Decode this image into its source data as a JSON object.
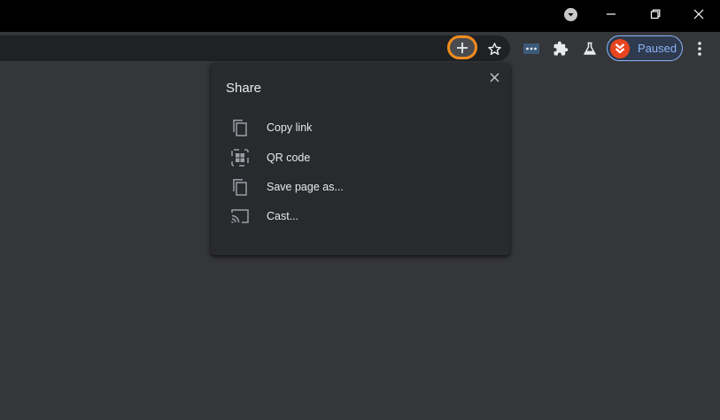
{
  "window_controls": {
    "icons": [
      "tab-search-icon",
      "minimize-icon",
      "restore-icon",
      "close-icon"
    ]
  },
  "toolbar": {
    "icons": [
      "share-icon",
      "bookmark-star-icon",
      "extension-dots-icon",
      "extensions-puzzle-icon",
      "labs-flask-icon",
      "more-menu-icon"
    ],
    "profile_label": "Paused",
    "accent_color": "#8ab4f8",
    "highlight_color": "#f28c1e"
  },
  "share_bubble": {
    "title": "Share",
    "items": [
      {
        "label": "Copy link",
        "icon": "copy-icon"
      },
      {
        "label": "QR code",
        "icon": "qr-code-icon"
      },
      {
        "label": "Save page as...",
        "icon": "save-page-icon"
      },
      {
        "label": "Cast...",
        "icon": "cast-icon"
      }
    ]
  }
}
